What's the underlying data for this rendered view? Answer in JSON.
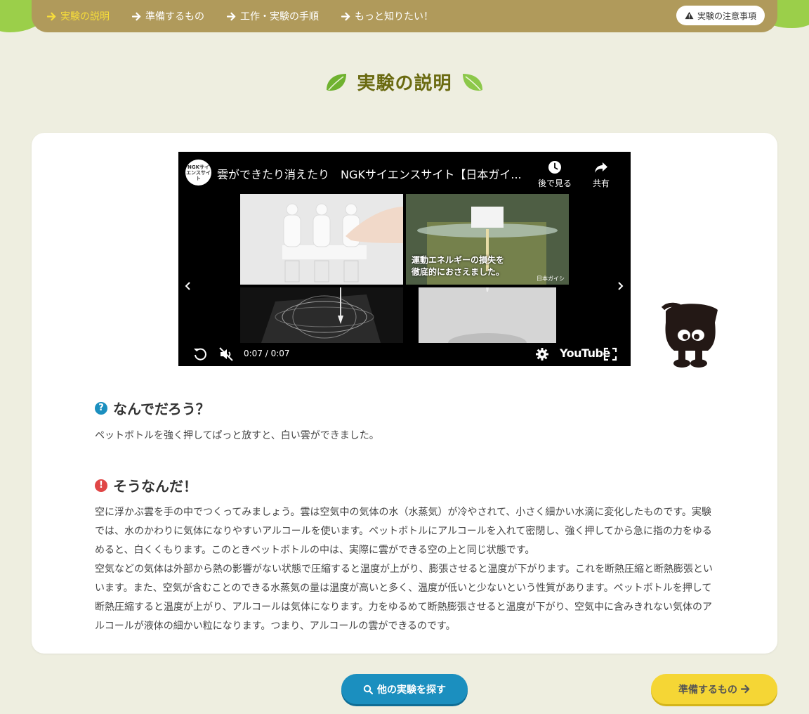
{
  "nav": {
    "items": [
      {
        "label": "実験の説明",
        "active": true
      },
      {
        "label": "準備するもの",
        "active": false
      },
      {
        "label": "工作・実験の手順",
        "active": false
      },
      {
        "label": "もっと知りたい！",
        "active": false
      }
    ],
    "caution_label": "実験の注意事項"
  },
  "page": {
    "title": "実験の説明"
  },
  "video": {
    "channel_logo_text": "NGKサイエンスサイト",
    "title": "雲ができたり消えたり　NGKサイエンスサイト【日本ガイ...",
    "watch_later_label": "後で見る",
    "share_label": "共有",
    "thumb_caption_line1": "運動エネルギーの損失を",
    "thumb_caption_line2": "徹底的におさえました。",
    "thumb_brand": "日本ガイシ",
    "time": "0:07 / 0:07",
    "youtube_logo": "YouTube"
  },
  "sections": {
    "question": {
      "heading": "なんでだろう？",
      "icon": "?",
      "text": "ペットボトルを強く押してぱっと放すと、白い雲ができました。"
    },
    "answer": {
      "heading": "そうなんだ！",
      "icon": "!",
      "paragraphs": [
        "空に浮かぶ雲を手の中でつくってみましょう。雲は空気中の気体の水（水蒸気）が冷やされて、小さく細かい水滴に変化したものです。実験では、水のかわりに気体になりやすいアルコールを使います。ペットボトルにアルコールを入れて密閉し、強く押してから急に指の力をゆるめると、白くくもります。このときペットボトルの中は、実際に雲ができる空の上と同じ状態です。",
        "空気などの気体は外部から熱の影響がない状態で圧縮すると温度が上がり、膨張させると温度が下がります。これを断熱圧縮と断熱膨張といいます。また、空気が含むことのできる水蒸気の量は温度が高いと多く、温度が低いと少ないという性質があります。ペットボトルを押して断熱圧縮すると温度が上がり、アルコールは気体になります。力をゆるめて断熱膨張させると温度が下がり、空気中に含みきれない気体のアルコールが液体の細かい粒になります。つまり、アルコールの雲ができるのです。"
      ]
    }
  },
  "buttons": {
    "search_label": "他の実験を探す",
    "next_label": "準備するもの"
  },
  "colors": {
    "nav_bg": "#b09a5b",
    "active_nav": "#f7dd3a",
    "title": "#6a6a10",
    "question_icon": "#1b8fbf",
    "answer_icon": "#e04646",
    "search_button": "#1b8fbf",
    "next_button": "#f5d635"
  }
}
